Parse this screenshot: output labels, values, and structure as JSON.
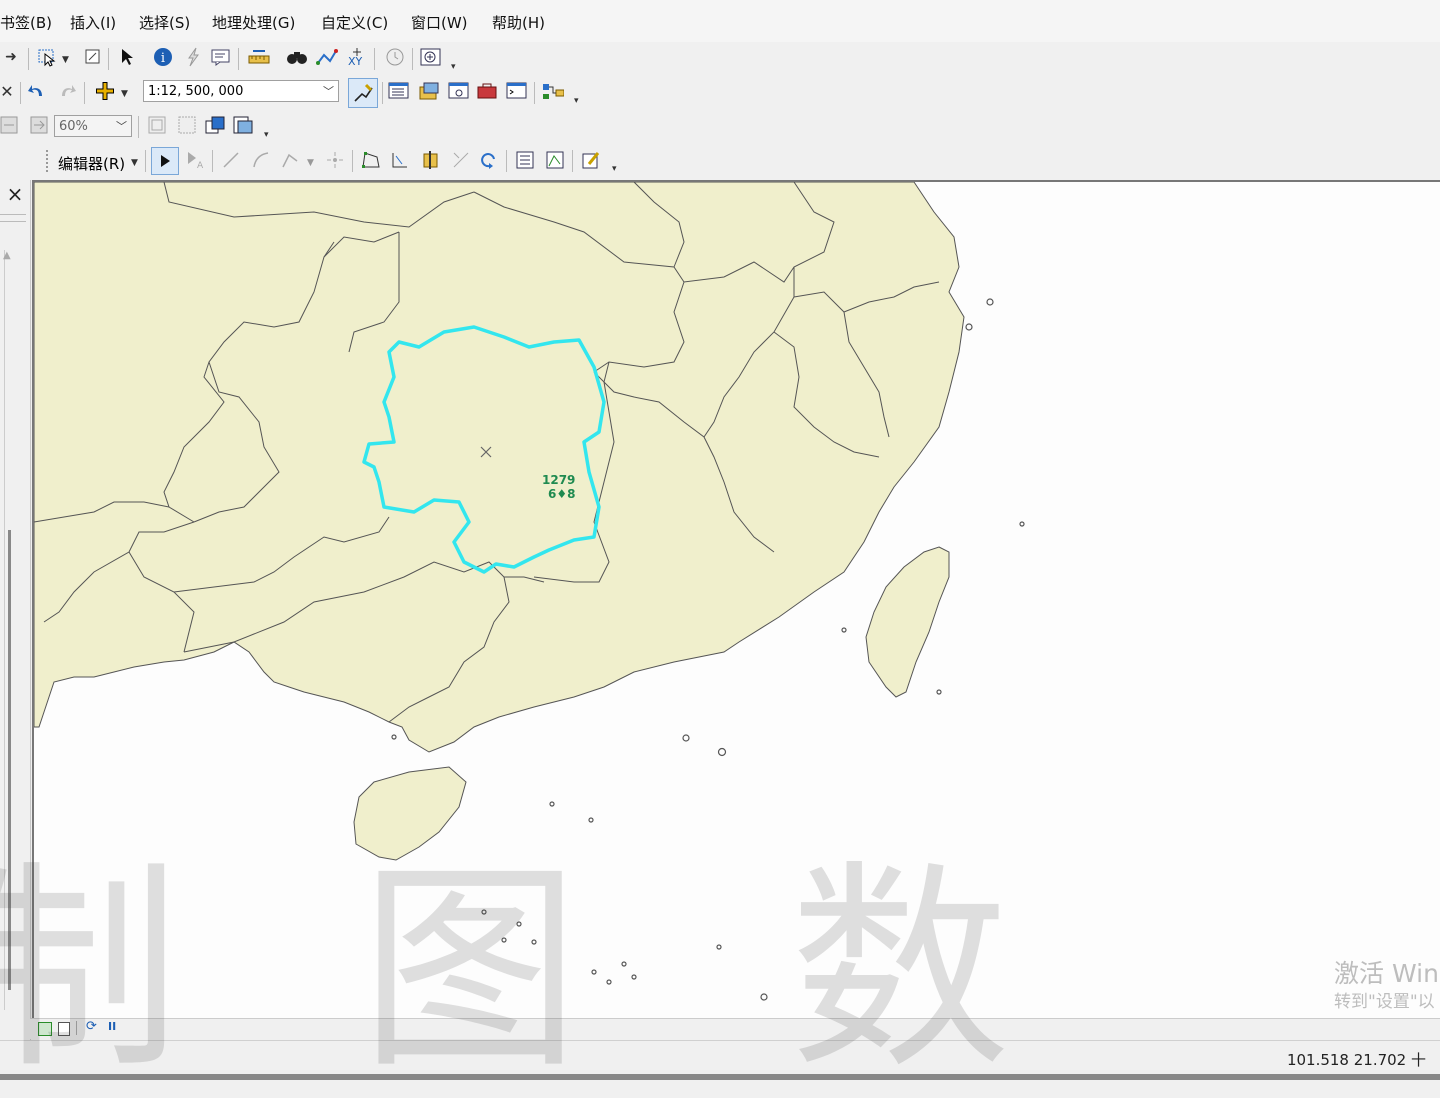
{
  "menu": {
    "items": [
      "书签(B)",
      "插入(I)",
      "选择(S)",
      "地理处理(G)",
      "自定义(C)",
      "窗口(W)",
      "帮助(H)"
    ]
  },
  "toolbar": {
    "scale_value": "1:12, 500, 000",
    "zoom_value": "60%",
    "editor_label": "编辑器(R)"
  },
  "panel": {
    "close_glyph": "×"
  },
  "map": {
    "feature_label_line1": "1279",
    "feature_label_line2": "6♦8",
    "land_color": "#f0efcc",
    "boundary_color": "#555555",
    "highlight_color": "#33e6ee",
    "sea_color": "#fdfdfd"
  },
  "status": {
    "coordinates": "101.518  21.702 十"
  },
  "overlay": {
    "activation_line1": "激活 Win",
    "activation_line2": "转到\"设置\"以",
    "watermark_chars": [
      "制",
      "图",
      "数"
    ]
  }
}
